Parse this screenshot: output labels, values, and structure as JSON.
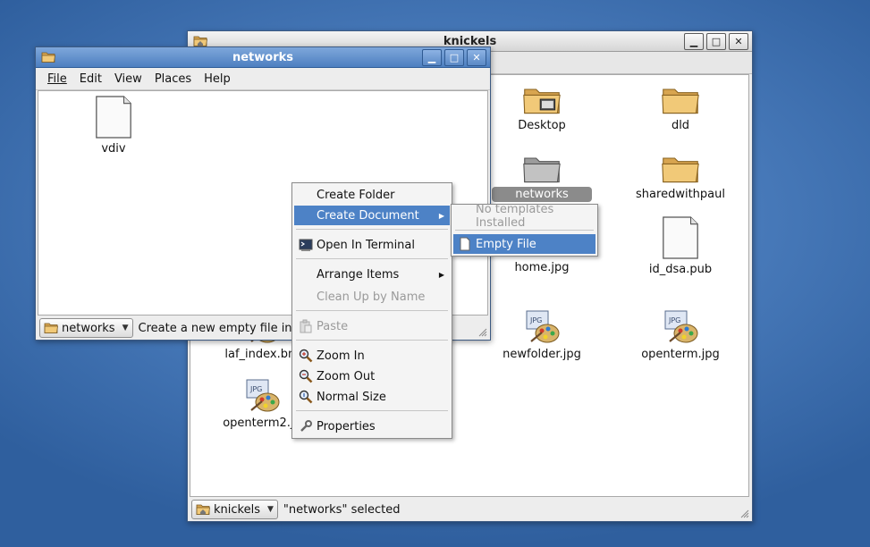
{
  "knickels_window": {
    "title": "knickels",
    "files": [
      {
        "name": "Desktop",
        "icon": "desktop-folder-icon"
      },
      {
        "name": "dld",
        "icon": "folder-icon"
      },
      {
        "name": "networks",
        "icon": "folder-icon",
        "selected": true
      },
      {
        "name": "sharedwithpaul",
        "icon": "folder-icon"
      },
      {
        "name": "home.jpg",
        "icon": "jpg-image-icon"
      },
      {
        "name": "id_dsa.pub",
        "icon": "blank-document-icon"
      },
      {
        "name": "laf_index.bm",
        "icon": "image-icon"
      },
      {
        "name": "newfolder.jpg",
        "icon": "jpg-image-icon"
      },
      {
        "name": "openterm.jpg",
        "icon": "jpg-image-icon"
      },
      {
        "name": "openterm2.jp",
        "icon": "jpg-image-icon"
      }
    ],
    "location_button": "knickels",
    "status": "\"networks\" selected"
  },
  "networks_window": {
    "title": "networks",
    "menu": [
      "File",
      "Edit",
      "View",
      "Places",
      "Help"
    ],
    "files": [
      {
        "name": "vdiv",
        "icon": "blank-document-icon"
      }
    ],
    "location_button": "networks",
    "status": "Create a new empty file inside t"
  },
  "context_menu": {
    "create_folder": "Create Folder",
    "create_document": "Create Document",
    "open_in_terminal": "Open In Terminal",
    "arrange_items": "Arrange Items",
    "clean_up": "Clean Up by Name",
    "paste": "Paste",
    "zoom_in": "Zoom In",
    "zoom_out": "Zoom Out",
    "normal_size": "Normal Size",
    "properties": "Properties"
  },
  "submenu": {
    "no_templates": "No templates Installed",
    "empty_file": "Empty File"
  },
  "colors": {
    "highlight": "#4d82c6",
    "active_titlebar": "#5f8ccb",
    "folder": "#e9bd6a"
  }
}
